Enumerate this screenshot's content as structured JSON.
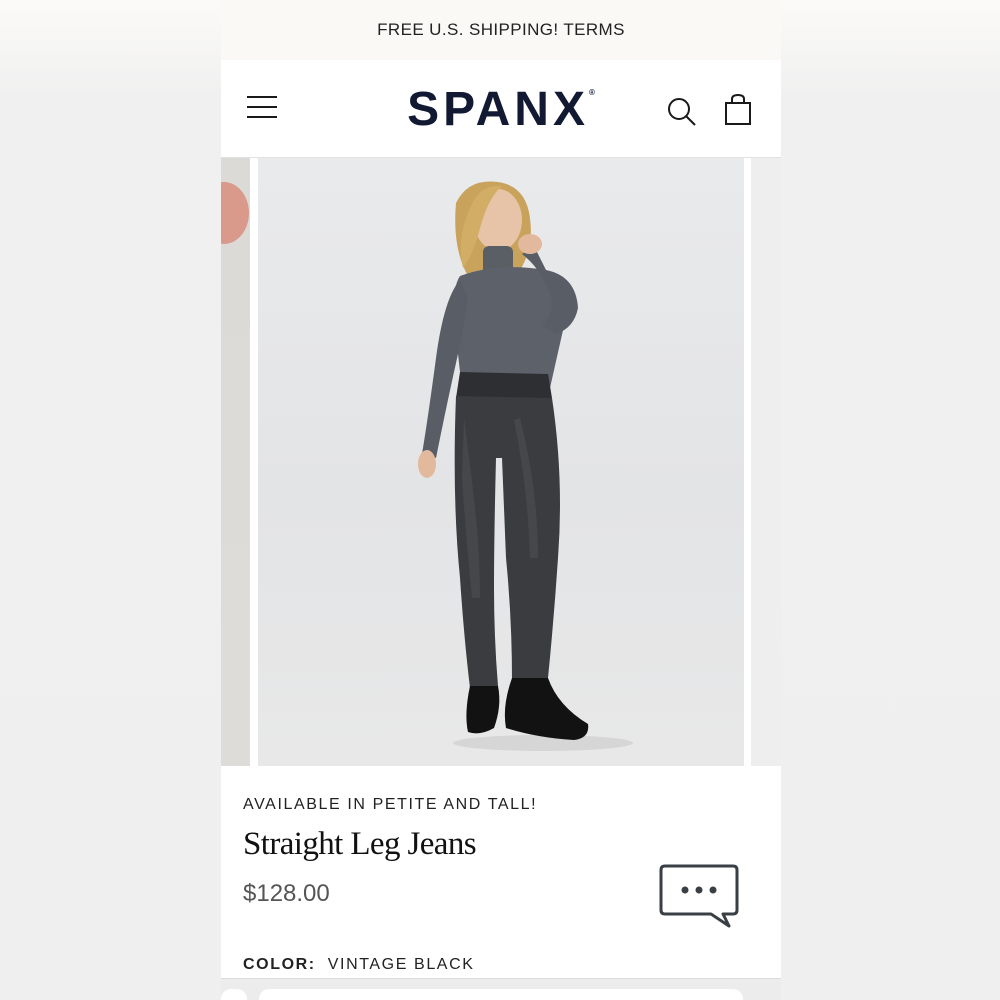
{
  "promo": {
    "text": "FREE U.S. SHIPPING! TERMS"
  },
  "header": {
    "logo_text": "SPANX",
    "logo_mark": "®",
    "menu_icon": "hamburger-menu-icon",
    "search_icon": "search-icon",
    "bag_icon": "shopping-bag-icon"
  },
  "product": {
    "eyebrow": "AVAILABLE IN PETITE AND TALL!",
    "title": "Straight Leg Jeans",
    "price": "$128.00",
    "color_label": "COLOR:",
    "color_value": "VINTAGE BLACK"
  },
  "chat": {
    "icon": "chat-bubble-icon"
  },
  "colors": {
    "logo": "#121a33",
    "promo_bg": "#fbf9f6",
    "text": "#222222",
    "price": "#555555"
  }
}
